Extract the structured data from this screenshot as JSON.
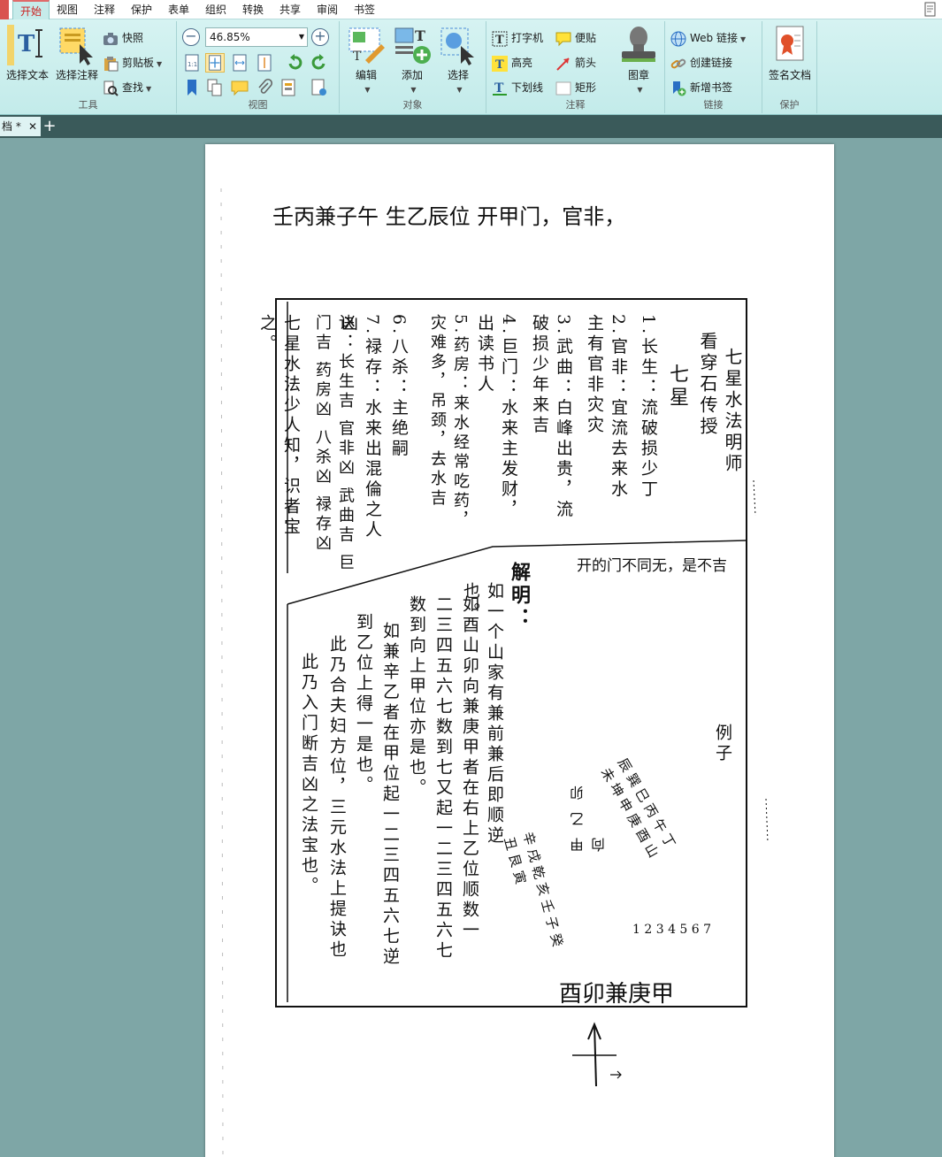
{
  "menubar": {
    "tabs": [
      "开始",
      "视图",
      "注释",
      "保护",
      "表单",
      "组织",
      "转换",
      "共享",
      "审阅",
      "书签"
    ],
    "active": "开始"
  },
  "ribbon": {
    "tools": {
      "label": "工具",
      "select_text": "选择文本",
      "select_annot": "选择注释",
      "snapshot": "快照",
      "clipboard": "剪贴板",
      "find": "查找"
    },
    "view": {
      "label": "视图",
      "zoom": "46.85%"
    },
    "objects": {
      "label": "对象",
      "edit": "编辑",
      "add": "添加",
      "select": "选择"
    },
    "comments": {
      "label": "注释",
      "typewriter": "打字机",
      "note": "便贴",
      "highlight": "高亮",
      "arrow": "箭头",
      "underline": "下划线",
      "rect": "矩形",
      "stamp": "图章"
    },
    "links": {
      "label": "链接",
      "web": "Web 链接",
      "create": "创建链接",
      "bookmark": "新增书签"
    },
    "protect": {
      "label": "保护",
      "sign": "签名文档"
    }
  },
  "tabstrip": {
    "doc_tab": "档 *",
    "close": "✕",
    "new": "+"
  },
  "document": {
    "top_line": "壬丙兼子午  生乙辰位  开甲门，官非，",
    "title": "七星水法明师",
    "subtitle": "看穿石传授",
    "heading": "七星",
    "stars": [
      "1.长生：流破损少丁",
      "2.官非：宜流去来水  主有官非灾灾",
      "3.武曲：白峰出贵，流破损少年来吉",
      "4.巨门：水来主发财，出读书人",
      "5.药房：来水经常吃药，灾难多，吊颈，去水吉",
      "6.八杀：主绝嗣",
      "7.禄存：水来出混倫之人凶"
    ],
    "verse": "诀：长生吉  官非凶  武曲吉  巨门吉  药房凶  八杀凶  禄存凶",
    "verse_end": "七星水法少人知，识者宝之。",
    "margin_note": "开的门不同无，是不吉",
    "explain_title": "解明：",
    "explain": [
      "如一个山家有兼前兼后即顺逆也。",
      "如酉山卯向兼庚甲者在右上乙位顺数一",
      "二三四五六七数到七又起一二三四五六七",
      "数到向上甲位亦是也。",
      "如兼辛乙者在甲位起一二三四五六七逆",
      "到乙位上得一是也。",
      "此乃合夫妇方位，三元水法上提诀也",
      "此乃入门断吉凶之法宝也。"
    ],
    "example": "例子",
    "wheel_left": "甲 乙 卯 向",
    "wheel_right": "辰 巽 巳 丙 午 丁 未 坤 申 庚 酉 山",
    "wheel_bottom": "辛 戌 乾 亥 壬 子 癸 丑 艮 寅",
    "wheel_nums": "1 2 3 4 5 6 7",
    "bottom_label": "酉卯兼庚甲"
  }
}
